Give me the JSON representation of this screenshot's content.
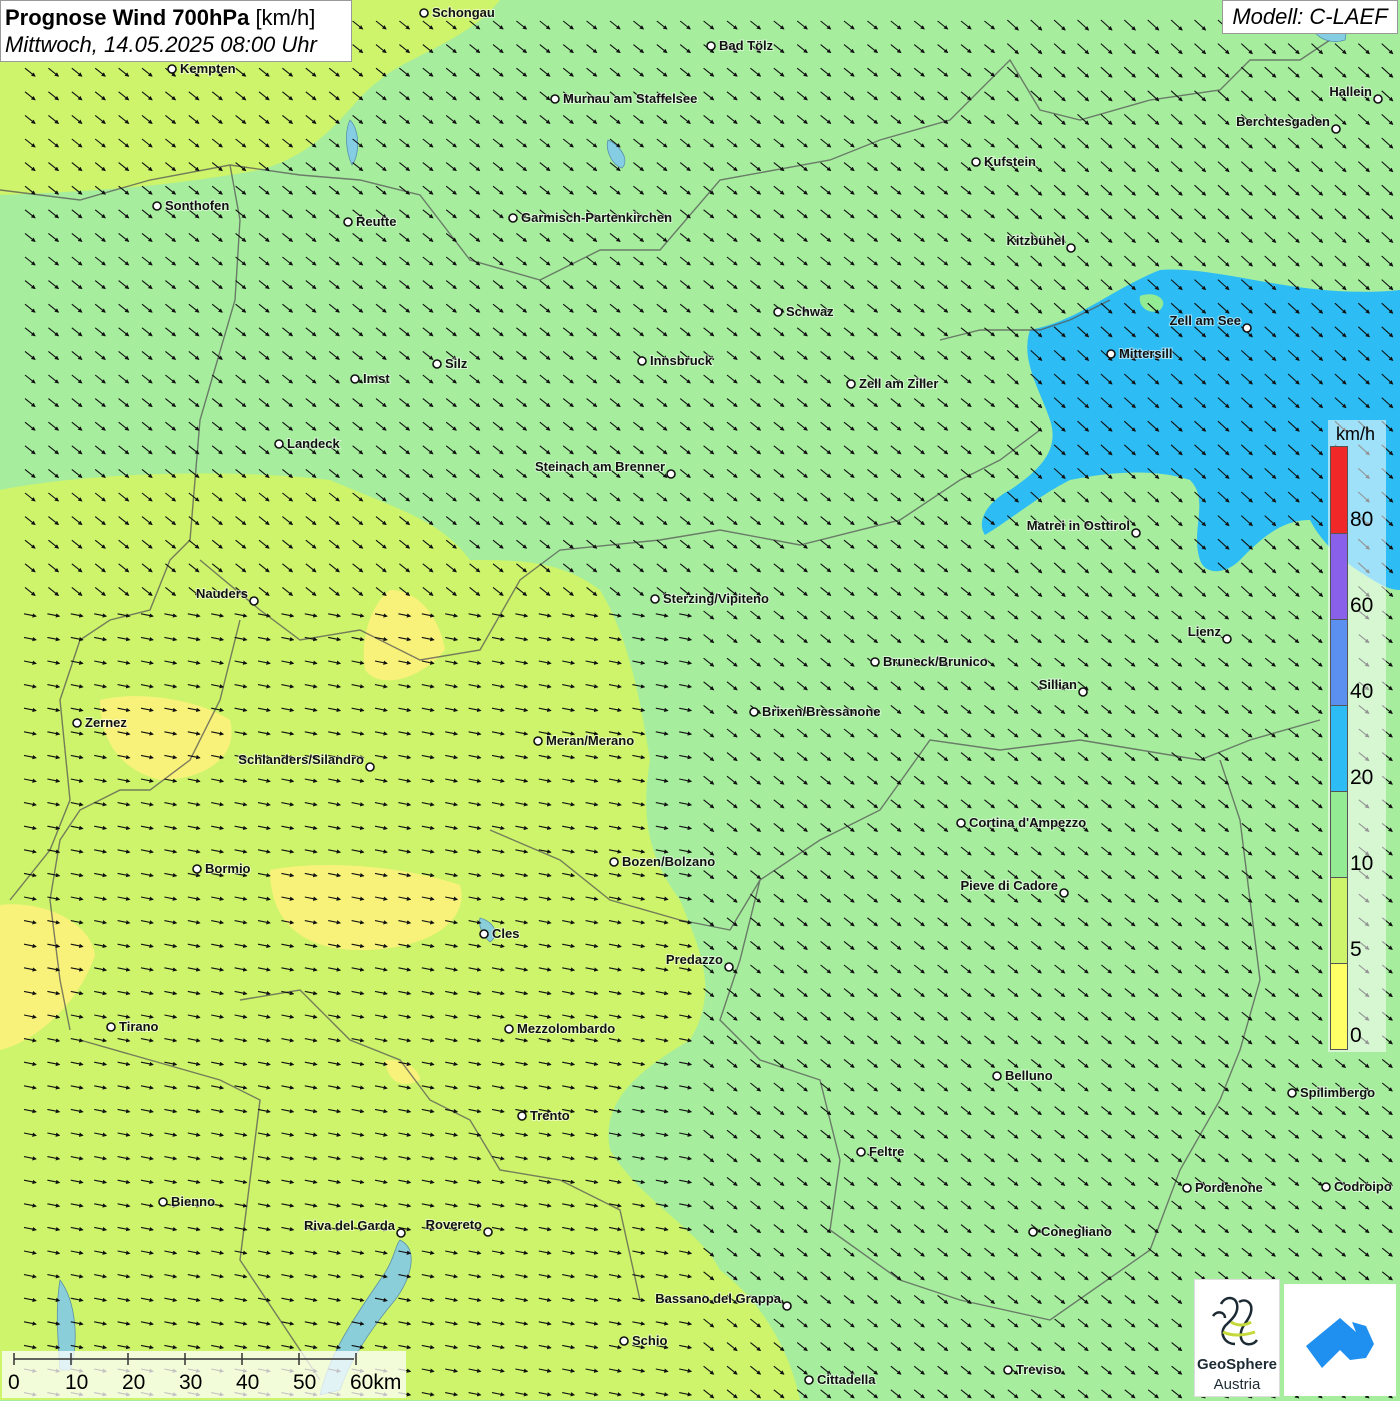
{
  "title": {
    "main": "Prognose Wind 700hPa",
    "unit": "[km/h]",
    "datetime": "Mittwoch, 14.05.2025 08:00 Uhr"
  },
  "model": "Modell: C-LAEF",
  "legend": {
    "unit": "km/h",
    "ticks": [
      "0",
      "5",
      "10",
      "20",
      "40",
      "60",
      "80"
    ],
    "colors": [
      "#ffff66",
      "#cdf46a",
      "#93eb93",
      "#2dbdf4",
      "#5b8ff0",
      "#8860ea",
      "#f02828"
    ]
  },
  "scale_bar": {
    "labels": [
      "0",
      "10",
      "20",
      "30",
      "40",
      "50",
      "60km"
    ]
  },
  "wind_zone_colors": {
    "yellow": "#f9f27a",
    "yellow_green": "#cdf46a",
    "green": "#a6ee9e",
    "blue": "#2dbdf4"
  },
  "cities": [
    {
      "name": "Schongau"
    },
    {
      "name": "Bad Tölz"
    },
    {
      "name": "Kempten"
    },
    {
      "name": "Murnau am Staffelsee"
    },
    {
      "name": "Hallein"
    },
    {
      "name": "Berchtesgaden"
    },
    {
      "name": "Kufstein"
    },
    {
      "name": "Sonthofen"
    },
    {
      "name": "Reutte"
    },
    {
      "name": "Garmisch-Partenkirchen"
    },
    {
      "name": "Kitzbühel"
    },
    {
      "name": "Schwaz"
    },
    {
      "name": "Zell am See"
    },
    {
      "name": "Mittersill"
    },
    {
      "name": "Innsbruck"
    },
    {
      "name": "Silz"
    },
    {
      "name": "Imst"
    },
    {
      "name": "Zell am Ziller"
    },
    {
      "name": "Landeck"
    },
    {
      "name": "Steinach am Brenner"
    },
    {
      "name": "Matrei in Osttirol"
    },
    {
      "name": "Nauders"
    },
    {
      "name": "Sterzing/Vipiteno"
    },
    {
      "name": "Lienz"
    },
    {
      "name": "Bruneck/Brunico"
    },
    {
      "name": "Sillian"
    },
    {
      "name": "Brixen/Bressanone"
    },
    {
      "name": "Zernez"
    },
    {
      "name": "Meran/Merano"
    },
    {
      "name": "Schlanders/Silandro"
    },
    {
      "name": "Cortina d'Ampezzo"
    },
    {
      "name": "Bozen/Bolzano"
    },
    {
      "name": "Bormio"
    },
    {
      "name": "Pieve di Cadore"
    },
    {
      "name": "Cles"
    },
    {
      "name": "Predazzo"
    },
    {
      "name": "Tirano"
    },
    {
      "name": "Mezzolombardo"
    },
    {
      "name": "Belluno"
    },
    {
      "name": "Spilimbergo"
    },
    {
      "name": "Trento"
    },
    {
      "name": "Feltre"
    },
    {
      "name": "Pordenone"
    },
    {
      "name": "Codroipo"
    },
    {
      "name": "Bienno"
    },
    {
      "name": "Riva del Garda"
    },
    {
      "name": "Rovereto"
    },
    {
      "name": "Conegliano"
    },
    {
      "name": "Bassano del Grappa"
    },
    {
      "name": "Schio"
    },
    {
      "name": "Treviso"
    },
    {
      "name": "Cittadella"
    }
  ],
  "logos": {
    "geosphere_line1": "GeoSphere",
    "geosphere_line2": "Austria"
  }
}
